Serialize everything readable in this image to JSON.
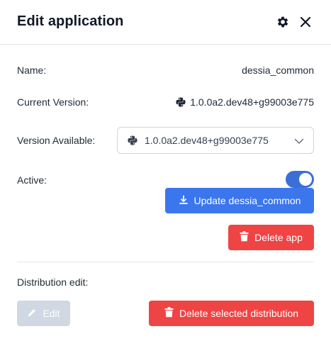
{
  "header": {
    "title": "Edit application"
  },
  "fields": {
    "name_label": "Name:",
    "name_value": "dessia_common",
    "current_version_label": "Current Version:",
    "current_version_value": "1.0.0a2.dev48+g99003e775",
    "version_available_label": "Version Available:",
    "version_available_selected": "1.0.0a2.dev48+g99003e775",
    "active_label": "Active:",
    "active": true
  },
  "buttons": {
    "update_label": "Update dessia_common",
    "delete_app_label": "Delete app",
    "edit_label": "Edit",
    "delete_distribution_label": "Delete selected distribution"
  },
  "distribution": {
    "label": "Distribution edit:"
  },
  "icons": {
    "settings": "gear-icon",
    "close": "close-icon",
    "python": "python-icon",
    "chevron": "chevron-down-icon",
    "download": "download-icon",
    "trash": "trash-icon",
    "pencil": "pencil-icon"
  },
  "colors": {
    "primary": "#3b76ed",
    "danger": "#ef4444",
    "disabled": "#cfd8e3",
    "toggle_on": "#3b6fd8"
  }
}
